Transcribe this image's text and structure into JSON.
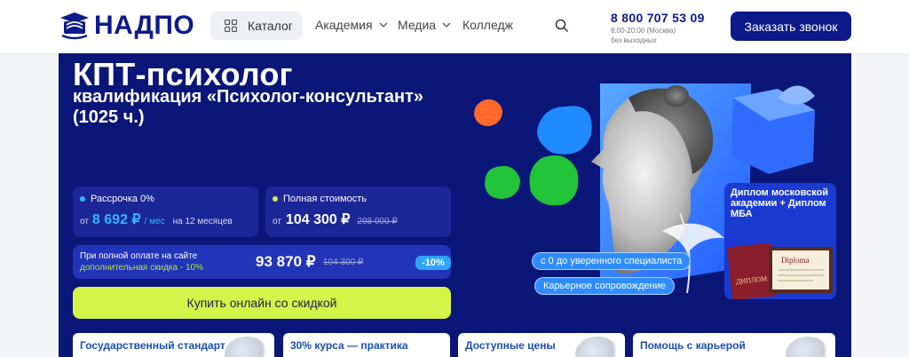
{
  "header": {
    "logo_text": "НАДПО",
    "catalog_label": "Каталог",
    "nav": [
      "Академия",
      "Медиа",
      "Колледж"
    ],
    "phone": "8 800 707 53 09",
    "hours_line1": "8:00-20:00 (Москва)",
    "hours_line2": "без выходных",
    "call_button": "Заказать звонок"
  },
  "hero": {
    "title": "КПТ-психолог",
    "subtitle": "квалификация «Психолог-консультант» (1025 ч.)",
    "installment": {
      "label": "Рассрочка 0%",
      "prefix": "от",
      "amount": "8 692 ₽",
      "unit": "/ мес",
      "term": "на 12 месяцев",
      "dot_color": "#33b5ff"
    },
    "full_price": {
      "label": "Полная стоимость",
      "prefix": "от",
      "amount": "104 300 ₽",
      "old_amount": "298 000 ₽",
      "dot_color": "#d5f449"
    },
    "discount": {
      "line1": "При полной оплате на сайте",
      "line2": "дополнительная скидка - 10%",
      "amount": "93 870 ₽",
      "old_amount": "104 300 ₽",
      "badge": "-10%"
    },
    "buy_button": "Купить онлайн со скидкой",
    "features": [
      "Государственный стандарт",
      "30% курса — практика",
      "Доступные цены",
      "Помощь с карьерой"
    ],
    "tags": [
      "с 0 до уверенного специалиста",
      "Карьерное сопровождение"
    ],
    "diploma_text": "Диплом московской академии + Диплом МБА",
    "diploma_doc_text": "ДИПЛОМ",
    "diploma_doc_text2": "Diploma"
  },
  "colors": {
    "brand": "#0e1a8a",
    "hero_bg": "#0a1678",
    "accent_green": "#d5f449",
    "accent_blue": "#33b5ff"
  }
}
